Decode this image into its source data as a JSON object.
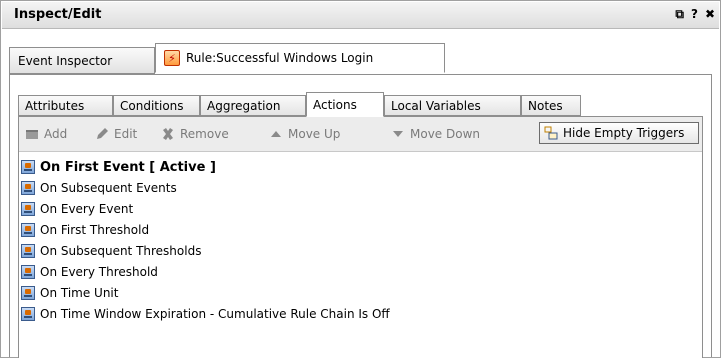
{
  "window": {
    "title": "Inspect/Edit",
    "controls": {
      "detach": "⧉",
      "help": "?",
      "close": "✖"
    }
  },
  "top_tabs": [
    {
      "label": "Event Inspector"
    },
    {
      "label": "Rule:Successful Windows Login"
    }
  ],
  "sub_tabs": [
    {
      "label": "Attributes"
    },
    {
      "label": "Conditions"
    },
    {
      "label": "Aggregation"
    },
    {
      "label": "Actions"
    },
    {
      "label": "Local Variables"
    },
    {
      "label": "Notes"
    }
  ],
  "toolbar": {
    "add": "Add",
    "edit": "Edit",
    "remove": "Remove",
    "move_up": "Move Up",
    "move_down": "Move Down",
    "hide_empty": "Hide Empty Triggers"
  },
  "triggers": [
    "On First Event [ Active ]",
    "On Subsequent Events",
    "On Every Event",
    "On First Threshold",
    "On Subsequent Thresholds",
    "On Every Threshold",
    "On Time Unit",
    "On Time Window Expiration - Cumulative Rule Chain Is Off"
  ]
}
